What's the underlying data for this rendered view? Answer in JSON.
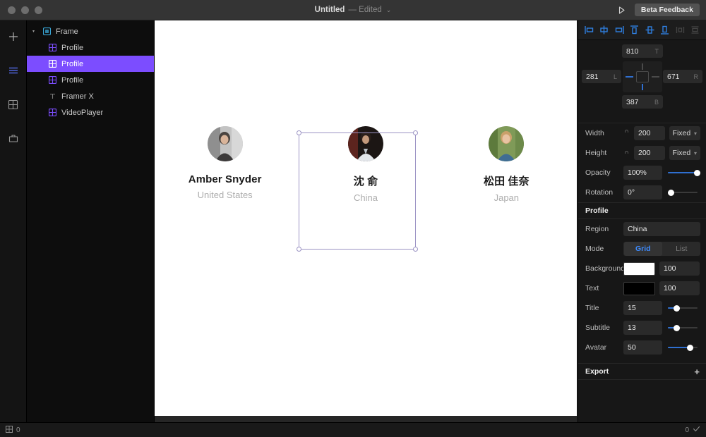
{
  "titlebar": {
    "doc_name": "Untitled",
    "edited_label": "— Edited",
    "chevron": "⌄",
    "play_icon": "play-icon",
    "beta_label": "Beta Feedback"
  },
  "rail": {
    "items": [
      {
        "name": "add-icon",
        "glyph": "+"
      },
      {
        "name": "layers-icon",
        "glyph": "≡"
      },
      {
        "name": "components-icon",
        "glyph": "▦"
      },
      {
        "name": "assets-icon",
        "glyph": "▱"
      }
    ]
  },
  "layers": {
    "items": [
      {
        "label": "Frame",
        "type": "frame",
        "depth": 0,
        "selected": false,
        "disclosure": "▾"
      },
      {
        "label": "Profile",
        "type": "component",
        "depth": 1,
        "selected": false
      },
      {
        "label": "Profile",
        "type": "component",
        "depth": 1,
        "selected": true
      },
      {
        "label": "Profile",
        "type": "component",
        "depth": 1,
        "selected": false
      },
      {
        "label": "Framer X",
        "type": "text",
        "depth": 1,
        "selected": false
      },
      {
        "label": "VideoPlayer",
        "type": "component",
        "depth": 1,
        "selected": false
      }
    ]
  },
  "canvas": {
    "cards": [
      {
        "name": "Amber Snyder",
        "region": "United States",
        "selected": false
      },
      {
        "name": "沈 俞",
        "region": "China",
        "selected": true
      },
      {
        "name": "松田 佳奈",
        "region": "Japan",
        "selected": false
      }
    ]
  },
  "properties": {
    "align_buttons": [
      {
        "name": "align-left-icon",
        "active": true
      },
      {
        "name": "align-horizontal-center-icon",
        "active": true
      },
      {
        "name": "align-right-icon",
        "active": true
      },
      {
        "name": "align-top-icon",
        "active": true
      },
      {
        "name": "align-vertical-center-icon",
        "active": true
      },
      {
        "name": "align-bottom-icon",
        "active": true
      },
      {
        "name": "distribute-horizontal-icon",
        "active": false
      },
      {
        "name": "distribute-vertical-icon",
        "active": false
      }
    ],
    "position": {
      "top": {
        "value": "810",
        "suffix": "T"
      },
      "left": {
        "value": "281",
        "suffix": "L"
      },
      "right": {
        "value": "671",
        "suffix": "R"
      },
      "bottom": {
        "value": "387",
        "suffix": "B"
      }
    },
    "size": {
      "width_label": "Width",
      "width_value": "200",
      "width_mode": "Fixed",
      "height_label": "Height",
      "height_value": "200",
      "height_mode": "Fixed"
    },
    "opacity": {
      "label": "Opacity",
      "value": "100%",
      "percent": 100
    },
    "rotation": {
      "label": "Rotation",
      "value": "0°",
      "percent": 0
    },
    "profile_section": {
      "title": "Profile",
      "region_label": "Region",
      "region_value": "China",
      "mode_label": "Mode",
      "mode_grid": "Grid",
      "mode_list": "List",
      "mode_selected": "Grid",
      "background_label": "Background",
      "background_color": "#ffffff",
      "background_alpha": "100",
      "text_label": "Text",
      "text_color": "#000000",
      "text_alpha": "100",
      "title_label": "Title",
      "title_value": "15",
      "title_percent": 22,
      "subtitle_label": "Subtitle",
      "subtitle_value": "13",
      "subtitle_percent": 22,
      "avatar_label": "Avatar",
      "avatar_value": "50",
      "avatar_percent": 63
    },
    "export": {
      "title": "Export",
      "add_glyph": "+"
    }
  },
  "status": {
    "left_icon": "grid-icon",
    "left_value": "0",
    "right_value": "0",
    "right_icon": "check-icon"
  },
  "colors": {
    "selection_purple": "#7c4dff",
    "accent_blue": "#2f6fd0",
    "active_blue": "#3d8bff"
  }
}
